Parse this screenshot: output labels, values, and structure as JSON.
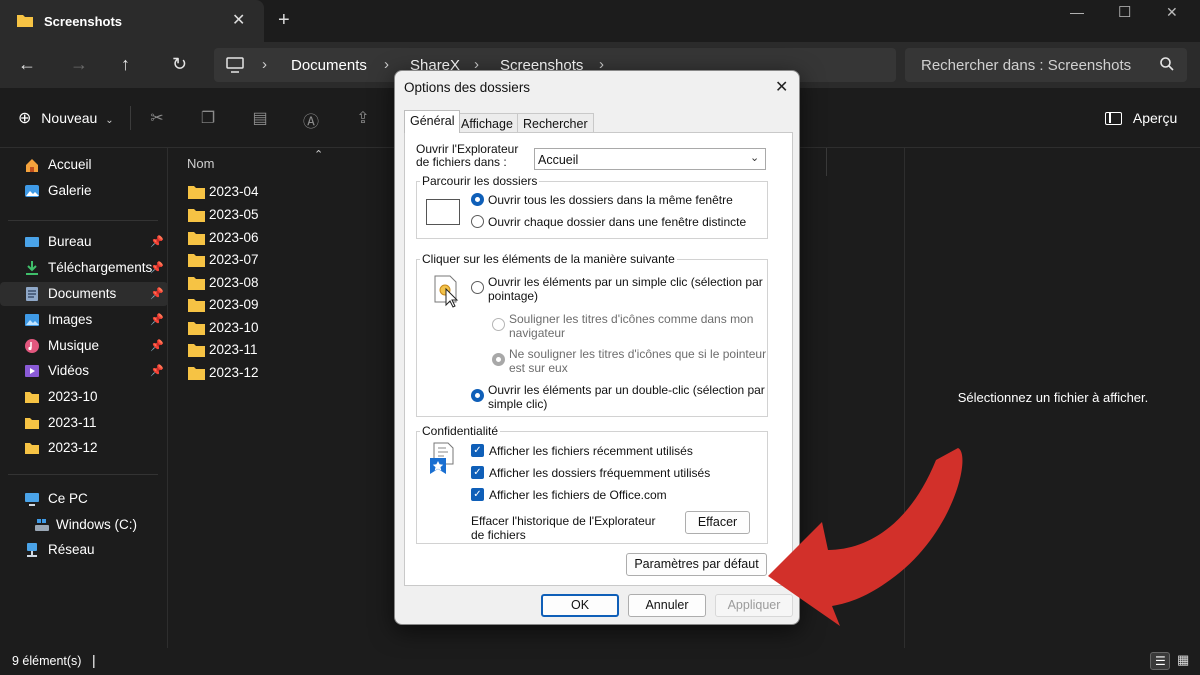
{
  "tab": {
    "title": "Screenshots"
  },
  "address": {
    "crumbs": [
      "Documents",
      "ShareX",
      "Screenshots"
    ]
  },
  "search": {
    "placeholder": "Rechercher dans : Screenshots"
  },
  "toolbar": {
    "new_label": "Nouveau",
    "preview_label": "Aperçu"
  },
  "sidebar": {
    "items": [
      {
        "label": "Accueil",
        "icon": "home-icon"
      },
      {
        "label": "Galerie",
        "icon": "gallery-icon"
      },
      {
        "label": "Bureau",
        "icon": "desktop-icon",
        "pinned": true
      },
      {
        "label": "Téléchargements",
        "icon": "download-icon",
        "pinned": true
      },
      {
        "label": "Documents",
        "icon": "documents-icon",
        "pinned": true,
        "selected": true
      },
      {
        "label": "Images",
        "icon": "pictures-icon",
        "pinned": true
      },
      {
        "label": "Musique",
        "icon": "music-icon",
        "pinned": true
      },
      {
        "label": "Vidéos",
        "icon": "videos-icon",
        "pinned": true
      },
      {
        "label": "2023-10",
        "icon": "folder-icon"
      },
      {
        "label": "2023-11",
        "icon": "folder-icon"
      },
      {
        "label": "2023-12",
        "icon": "folder-icon"
      },
      {
        "label": "Ce PC",
        "icon": "pc-icon"
      },
      {
        "label": "Windows (C:)",
        "icon": "drive-icon"
      },
      {
        "label": "Réseau",
        "icon": "network-icon"
      }
    ]
  },
  "filelist": {
    "column_name": "Nom",
    "files": [
      "2023-04",
      "2023-05",
      "2023-06",
      "2023-07",
      "2023-08",
      "2023-09",
      "2023-10",
      "2023-11",
      "2023-12"
    ]
  },
  "preview": {
    "message": "Sélectionnez un fichier à afficher."
  },
  "status": {
    "count": "9 élément(s)"
  },
  "dialog": {
    "title": "Options des dossiers",
    "tabs": [
      "Général",
      "Affichage",
      "Rechercher"
    ],
    "open_in_label_1": "Ouvrir l'Explorateur",
    "open_in_label_2": "de fichiers dans :",
    "open_in_value": "Accueil",
    "browse_group": "Parcourir les dossiers",
    "browse_same": "Ouvrir tous les dossiers dans la même fenêtre",
    "browse_distinct": "Ouvrir chaque dossier dans une fenêtre distincte",
    "click_group": "Cliquer sur les éléments de la manière suivante",
    "single_click_1": "Ouvrir les éléments par un simple clic (sélection par",
    "single_click_2": "pointage)",
    "underline_browser_1": "Souligner les titres d'icônes comme dans mon",
    "underline_browser_2": "navigateur",
    "underline_hover_1": "Ne souligner les titres d'icônes que si le pointeur",
    "underline_hover_2": "est sur eux",
    "double_click_1": "Ouvrir les éléments par un double-clic (sélection par",
    "double_click_2": "simple clic)",
    "privacy_group": "Confidentialité",
    "privacy_recent_files": "Afficher les fichiers récemment utilisés",
    "privacy_frequent_folders": "Afficher les dossiers fréquemment utilisés",
    "privacy_office": "Afficher les fichiers de Office.com",
    "clear_history_1": "Effacer l'historique de l'Explorateur",
    "clear_history_2": "de fichiers",
    "clear_button": "Effacer",
    "defaults_button": "Paramètres par défaut",
    "ok_button": "OK",
    "cancel_button": "Annuler",
    "apply_button": "Appliquer"
  },
  "colors": {
    "accent": "#0f5fb8",
    "folder": "#f6c344",
    "arrow": "#d2302a",
    "dark_bg": "#1c1c1c"
  }
}
